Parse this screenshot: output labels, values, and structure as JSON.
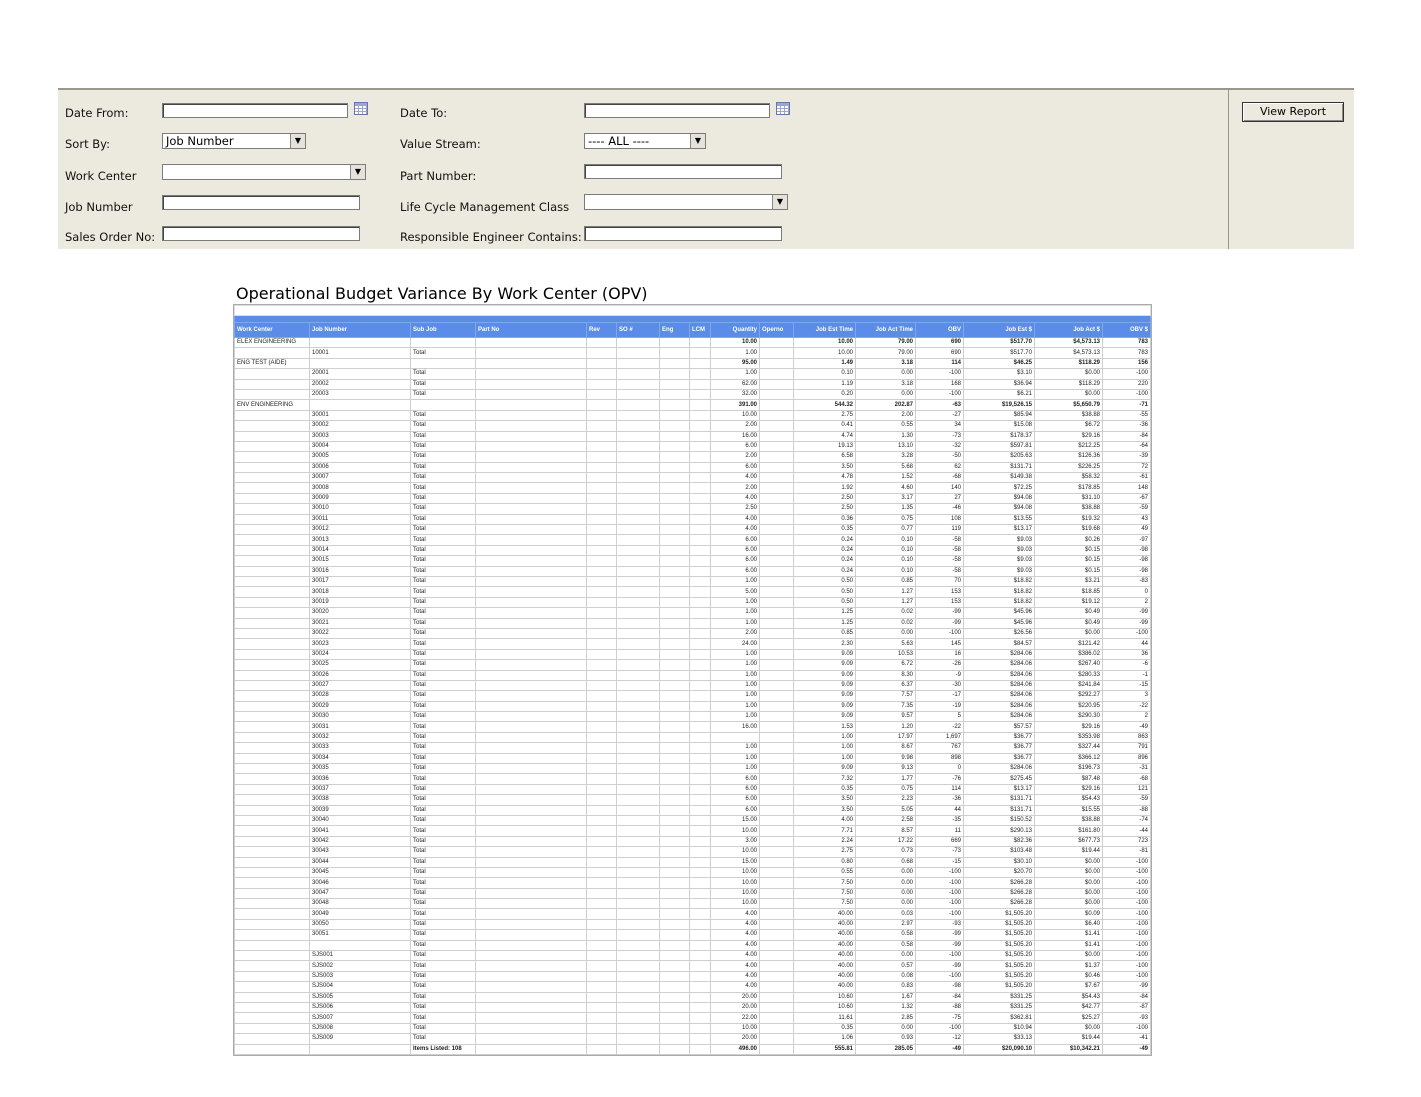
{
  "filters": {
    "date_from_label": "Date From:",
    "date_to_label": "Date To:",
    "sort_by_label": "Sort By:",
    "sort_by_value": "Job Number",
    "value_stream_label": "Value Stream:",
    "value_stream_value": "---- ALL ----",
    "work_center_label": "Work Center",
    "part_number_label": "Part Number:",
    "job_number_label": "Job Number",
    "lcm_class_label": "Life Cycle Management Class",
    "sales_order_label": "Sales Order No:",
    "resp_engineer_label": "Responsible Engineer Contains:",
    "view_report_label": "View Report"
  },
  "report": {
    "title": "Operational Budget Variance By Work Center (OPV)",
    "columns": [
      "Work Center",
      "Job Number",
      "Sub Job",
      "Part No",
      "Rev",
      "SO #",
      "Eng",
      "LCM",
      "Quantity",
      "Operno",
      "Job Est Time",
      "Job Act Time",
      "OBV",
      "Job Est $",
      "Job Act $",
      "OBV $"
    ],
    "rows": [
      [
        "ELEX ENGINEERING",
        "",
        "",
        "",
        "",
        "",
        "",
        "",
        "10.00",
        "",
        "10.00",
        "79.00",
        "690",
        "$517.70",
        "$4,573.13",
        "783"
      ],
      [
        "",
        "10001",
        "Total",
        "",
        "",
        "",
        "",
        "",
        "1.00",
        "",
        "10.00",
        "79.00",
        "690",
        "$517.70",
        "$4,573.13",
        "783"
      ],
      [
        "ENG TEST (AIDE)",
        "",
        "",
        "",
        "",
        "",
        "",
        "",
        "95.00",
        "",
        "1.49",
        "3.18",
        "114",
        "$46.25",
        "$118.29",
        "156"
      ],
      [
        "",
        "20001",
        "Total",
        "",
        "",
        "",
        "",
        "",
        "1.00",
        "",
        "0.10",
        "0.00",
        "-100",
        "$3.10",
        "$0.00",
        "-100"
      ],
      [
        "",
        "20002",
        "Total",
        "",
        "",
        "",
        "",
        "",
        "62.00",
        "",
        "1.19",
        "3.18",
        "168",
        "$36.94",
        "$118.29",
        "220"
      ],
      [
        "",
        "20003",
        "Total",
        "",
        "",
        "",
        "",
        "",
        "32.00",
        "",
        "0.20",
        "0.00",
        "-100",
        "$6.21",
        "$0.00",
        "-100"
      ],
      [
        "ENV ENGINEERING",
        "",
        "",
        "",
        "",
        "",
        "",
        "",
        "391.00",
        "",
        "544.32",
        "202.87",
        "-63",
        "$19,526.15",
        "$5,650.79",
        "-71"
      ],
      [
        "",
        "30001",
        "Total",
        "",
        "",
        "",
        "",
        "",
        "10.00",
        "",
        "2.75",
        "2.00",
        "-27",
        "$85.94",
        "$38.88",
        "-55"
      ],
      [
        "",
        "30002",
        "Total",
        "",
        "",
        "",
        "",
        "",
        "2.00",
        "",
        "0.41",
        "0.55",
        "34",
        "$15.08",
        "$6.72",
        "-36"
      ],
      [
        "",
        "30003",
        "Total",
        "",
        "",
        "",
        "",
        "",
        "16.00",
        "",
        "4.74",
        "1.30",
        "-73",
        "$178.37",
        "$29.16",
        "-84"
      ],
      [
        "",
        "30004",
        "Total",
        "",
        "",
        "",
        "",
        "",
        "6.00",
        "",
        "19.13",
        "13.10",
        "-32",
        "$597.81",
        "$212.25",
        "-64"
      ],
      [
        "",
        "30005",
        "Total",
        "",
        "",
        "",
        "",
        "",
        "2.00",
        "",
        "6.58",
        "3.28",
        "-50",
        "$205.63",
        "$126.36",
        "-39"
      ],
      [
        "",
        "30006",
        "Total",
        "",
        "",
        "",
        "",
        "",
        "6.00",
        "",
        "3.50",
        "5.68",
        "62",
        "$131.71",
        "$226.25",
        "72"
      ],
      [
        "",
        "30007",
        "Total",
        "",
        "",
        "",
        "",
        "",
        "4.00",
        "",
        "4.78",
        "1.52",
        "-68",
        "$149.38",
        "$58.32",
        "-61"
      ],
      [
        "",
        "30008",
        "Total",
        "",
        "",
        "",
        "",
        "",
        "2.00",
        "",
        "1.92",
        "4.60",
        "140",
        "$72.25",
        "$178.85",
        "148"
      ],
      [
        "",
        "30009",
        "Total",
        "",
        "",
        "",
        "",
        "",
        "4.00",
        "",
        "2.50",
        "3.17",
        "27",
        "$94.08",
        "$31.10",
        "-67"
      ],
      [
        "",
        "30010",
        "Total",
        "",
        "",
        "",
        "",
        "",
        "2.50",
        "",
        "2.50",
        "1.35",
        "-46",
        "$94.08",
        "$38.88",
        "-59"
      ],
      [
        "",
        "30011",
        "Total",
        "",
        "",
        "",
        "",
        "",
        "4.00",
        "",
        "0.36",
        "0.75",
        "108",
        "$13.55",
        "$19.32",
        "43"
      ],
      [
        "",
        "30012",
        "Total",
        "",
        "",
        "",
        "",
        "",
        "4.00",
        "",
        "0.35",
        "0.77",
        "119",
        "$13.17",
        "$19.68",
        "49"
      ],
      [
        "",
        "30013",
        "Total",
        "",
        "",
        "",
        "",
        "",
        "6.00",
        "",
        "0.24",
        "0.10",
        "-58",
        "$9.03",
        "$0.26",
        "-97"
      ],
      [
        "",
        "30014",
        "Total",
        "",
        "",
        "",
        "",
        "",
        "6.00",
        "",
        "0.24",
        "0.10",
        "-58",
        "$9.03",
        "$0.15",
        "-98"
      ],
      [
        "",
        "30015",
        "Total",
        "",
        "",
        "",
        "",
        "",
        "6.00",
        "",
        "0.24",
        "0.10",
        "-58",
        "$9.03",
        "$0.15",
        "-98"
      ],
      [
        "",
        "30016",
        "Total",
        "",
        "",
        "",
        "",
        "",
        "6.00",
        "",
        "0.24",
        "0.10",
        "-58",
        "$9.03",
        "$0.15",
        "-98"
      ],
      [
        "",
        "30017",
        "Total",
        "",
        "",
        "",
        "",
        "",
        "1.00",
        "",
        "0.50",
        "0.85",
        "70",
        "$18.82",
        "$3.21",
        "-83"
      ],
      [
        "",
        "30018",
        "Total",
        "",
        "",
        "",
        "",
        "",
        "5.00",
        "",
        "0.50",
        "1.27",
        "153",
        "$18.82",
        "$18.85",
        "0"
      ],
      [
        "",
        "30019",
        "Total",
        "",
        "",
        "",
        "",
        "",
        "1.00",
        "",
        "0.50",
        "1.27",
        "153",
        "$18.82",
        "$19.12",
        "2"
      ],
      [
        "",
        "30020",
        "Total",
        "",
        "",
        "",
        "",
        "",
        "1.00",
        "",
        "1.25",
        "0.02",
        "-99",
        "$45.96",
        "$0.49",
        "-99"
      ],
      [
        "",
        "30021",
        "Total",
        "",
        "",
        "",
        "",
        "",
        "1.00",
        "",
        "1.25",
        "0.02",
        "-99",
        "$45.96",
        "$0.49",
        "-99"
      ],
      [
        "",
        "30022",
        "Total",
        "",
        "",
        "",
        "",
        "",
        "2.00",
        "",
        "0.85",
        "0.00",
        "-100",
        "$26.56",
        "$0.00",
        "-100"
      ],
      [
        "",
        "30023",
        "Total",
        "",
        "",
        "",
        "",
        "",
        "24.00",
        "",
        "2.30",
        "5.63",
        "145",
        "$84.57",
        "$121.42",
        "44"
      ],
      [
        "",
        "30024",
        "Total",
        "",
        "",
        "",
        "",
        "",
        "1.00",
        "",
        "9.09",
        "10.53",
        "16",
        "$284.06",
        "$386.02",
        "36"
      ],
      [
        "",
        "30025",
        "Total",
        "",
        "",
        "",
        "",
        "",
        "1.00",
        "",
        "9.09",
        "6.72",
        "-26",
        "$284.06",
        "$267.40",
        "-6"
      ],
      [
        "",
        "30026",
        "Total",
        "",
        "",
        "",
        "",
        "",
        "1.00",
        "",
        "9.09",
        "8.30",
        "-9",
        "$284.06",
        "$280.33",
        "-1"
      ],
      [
        "",
        "30027",
        "Total",
        "",
        "",
        "",
        "",
        "",
        "1.00",
        "",
        "9.09",
        "6.37",
        "-30",
        "$284.06",
        "$241.84",
        "-15"
      ],
      [
        "",
        "30028",
        "Total",
        "",
        "",
        "",
        "",
        "",
        "1.00",
        "",
        "9.09",
        "7.57",
        "-17",
        "$284.06",
        "$292.27",
        "3"
      ],
      [
        "",
        "30029",
        "Total",
        "",
        "",
        "",
        "",
        "",
        "1.00",
        "",
        "9.09",
        "7.35",
        "-19",
        "$284.06",
        "$220.95",
        "-22"
      ],
      [
        "",
        "30030",
        "Total",
        "",
        "",
        "",
        "",
        "",
        "1.00",
        "",
        "9.09",
        "9.57",
        "5",
        "$284.06",
        "$290.30",
        "2"
      ],
      [
        "",
        "30031",
        "Total",
        "",
        "",
        "",
        "",
        "",
        "16.00",
        "",
        "1.53",
        "1.20",
        "-22",
        "$57.57",
        "$29.16",
        "-49"
      ],
      [
        "",
        "30032",
        "Total",
        "",
        "",
        "",
        "",
        "",
        "",
        "",
        "1.00",
        "17.97",
        "1,697",
        "$36.77",
        "$353.98",
        "863"
      ],
      [
        "",
        "30033",
        "Total",
        "",
        "",
        "",
        "",
        "",
        "1.00",
        "",
        "1.00",
        "8.67",
        "767",
        "$36.77",
        "$327.44",
        "791"
      ],
      [
        "",
        "30034",
        "Total",
        "",
        "",
        "",
        "",
        "",
        "1.00",
        "",
        "1.00",
        "9.98",
        "898",
        "$36.77",
        "$366.12",
        "896"
      ],
      [
        "",
        "30035",
        "Total",
        "",
        "",
        "",
        "",
        "",
        "1.00",
        "",
        "9.09",
        "9.13",
        "0",
        "$284.06",
        "$196.73",
        "-31"
      ],
      [
        "",
        "30036",
        "Total",
        "",
        "",
        "",
        "",
        "",
        "6.00",
        "",
        "7.32",
        "1.77",
        "-76",
        "$275.45",
        "$87.48",
        "-68"
      ],
      [
        "",
        "30037",
        "Total",
        "",
        "",
        "",
        "",
        "",
        "6.00",
        "",
        "0.35",
        "0.75",
        "114",
        "$13.17",
        "$29.16",
        "121"
      ],
      [
        "",
        "30038",
        "Total",
        "",
        "",
        "",
        "",
        "",
        "6.00",
        "",
        "3.50",
        "2.23",
        "-36",
        "$131.71",
        "$54.43",
        "-59"
      ],
      [
        "",
        "30039",
        "Total",
        "",
        "",
        "",
        "",
        "",
        "6.00",
        "",
        "3.50",
        "5.05",
        "44",
        "$131.71",
        "$15.55",
        "-88"
      ],
      [
        "",
        "30040",
        "Total",
        "",
        "",
        "",
        "",
        "",
        "15.00",
        "",
        "4.00",
        "2.58",
        "-35",
        "$150.52",
        "$38.88",
        "-74"
      ],
      [
        "",
        "30041",
        "Total",
        "",
        "",
        "",
        "",
        "",
        "10.00",
        "",
        "7.71",
        "8.57",
        "11",
        "$290.13",
        "$161.80",
        "-44"
      ],
      [
        "",
        "30042",
        "Total",
        "",
        "",
        "",
        "",
        "",
        "3.00",
        "",
        "2.24",
        "17.22",
        "669",
        "$82.36",
        "$677.73",
        "723"
      ],
      [
        "",
        "30043",
        "Total",
        "",
        "",
        "",
        "",
        "",
        "10.00",
        "",
        "2.75",
        "0.73",
        "-73",
        "$103.48",
        "$19.44",
        "-81"
      ],
      [
        "",
        "30044",
        "Total",
        "",
        "",
        "",
        "",
        "",
        "15.00",
        "",
        "0.80",
        "0.68",
        "-15",
        "$30.10",
        "$0.00",
        "-100"
      ],
      [
        "",
        "30045",
        "Total",
        "",
        "",
        "",
        "",
        "",
        "10.00",
        "",
        "0.55",
        "0.00",
        "-100",
        "$20.70",
        "$0.00",
        "-100"
      ],
      [
        "",
        "30046",
        "Total",
        "",
        "",
        "",
        "",
        "",
        "10.00",
        "",
        "7.50",
        "0.00",
        "-100",
        "$266.28",
        "$0.00",
        "-100"
      ],
      [
        "",
        "30047",
        "Total",
        "",
        "",
        "",
        "",
        "",
        "10.00",
        "",
        "7.50",
        "0.00",
        "-100",
        "$266.28",
        "$0.00",
        "-100"
      ],
      [
        "",
        "30048",
        "Total",
        "",
        "",
        "",
        "",
        "",
        "10.00",
        "",
        "7.50",
        "0.00",
        "-100",
        "$266.28",
        "$0.00",
        "-100"
      ],
      [
        "",
        "30049",
        "Total",
        "",
        "",
        "",
        "",
        "",
        "4.00",
        "",
        "40.00",
        "0.03",
        "-100",
        "$1,505.20",
        "$0.09",
        "-100"
      ],
      [
        "",
        "30050",
        "Total",
        "",
        "",
        "",
        "",
        "",
        "4.00",
        "",
        "40.00",
        "2.97",
        "-93",
        "$1,505.20",
        "$6.40",
        "-100"
      ],
      [
        "",
        "30051",
        "Total",
        "",
        "",
        "",
        "",
        "",
        "4.00",
        "",
        "40.00",
        "0.58",
        "-99",
        "$1,505.20",
        "$1.41",
        "-100"
      ],
      [
        "",
        "",
        "Total",
        "",
        "",
        "",
        "",
        "",
        "4.00",
        "",
        "40.00",
        "0.58",
        "-99",
        "$1,505.20",
        "$1.41",
        "-100"
      ],
      [
        "",
        "SJS001",
        "Total",
        "",
        "",
        "",
        "",
        "",
        "4.00",
        "",
        "40.00",
        "0.00",
        "-100",
        "$1,505.20",
        "$0.00",
        "-100"
      ],
      [
        "",
        "SJS002",
        "Total",
        "",
        "",
        "",
        "",
        "",
        "4.00",
        "",
        "40.00",
        "0.57",
        "-99",
        "$1,505.20",
        "$1.37",
        "-100"
      ],
      [
        "",
        "SJS003",
        "Total",
        "",
        "",
        "",
        "",
        "",
        "4.00",
        "",
        "40.00",
        "0.08",
        "-100",
        "$1,505.20",
        "$0.46",
        "-100"
      ],
      [
        "",
        "SJS004",
        "Total",
        "",
        "",
        "",
        "",
        "",
        "4.00",
        "",
        "40.00",
        "0.83",
        "-98",
        "$1,505.20",
        "$7.67",
        "-99"
      ],
      [
        "",
        "SJS005",
        "Total",
        "",
        "",
        "",
        "",
        "",
        "20.00",
        "",
        "10.60",
        "1.67",
        "-84",
        "$331.25",
        "$54.43",
        "-84"
      ],
      [
        "",
        "SJS006",
        "Total",
        "",
        "",
        "",
        "",
        "",
        "20.00",
        "",
        "10.60",
        "1.32",
        "-88",
        "$331.25",
        "$42.77",
        "-87"
      ],
      [
        "",
        "SJS007",
        "Total",
        "",
        "",
        "",
        "",
        "",
        "22.00",
        "",
        "11.61",
        "2.85",
        "-75",
        "$362.81",
        "$25.27",
        "-93"
      ],
      [
        "",
        "SJS008",
        "Total",
        "",
        "",
        "",
        "",
        "",
        "10.00",
        "",
        "0.35",
        "0.00",
        "-100",
        "$10.94",
        "$0.00",
        "-100"
      ],
      [
        "",
        "SJS009",
        "Total",
        "",
        "",
        "",
        "",
        "",
        "20.00",
        "",
        "1.06",
        "0.93",
        "-12",
        "$33.13",
        "$19.44",
        "-41"
      ],
      [
        "",
        "",
        "Items Listed: 108",
        "",
        "",
        "",
        "",
        "",
        "496.00",
        "",
        "555.81",
        "285.05",
        "-49",
        "$20,090.10",
        "$10,342.21",
        "-49"
      ]
    ]
  }
}
